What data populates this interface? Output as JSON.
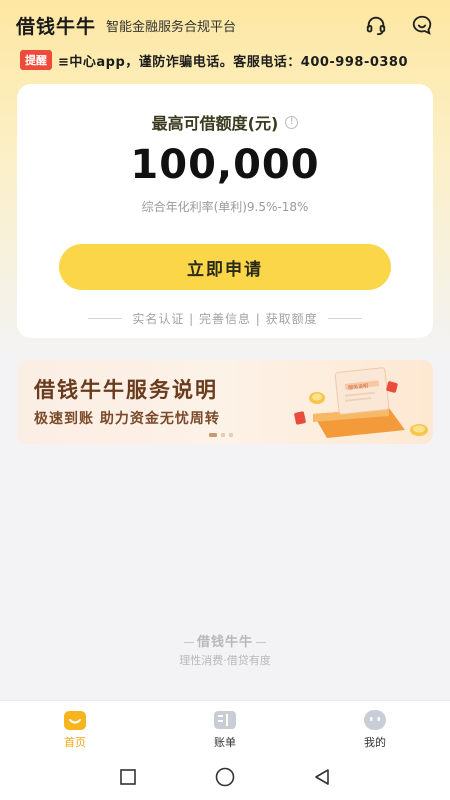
{
  "header": {
    "brand": "借钱牛牛",
    "slogan": "智能金融服务合规平台",
    "icons": [
      "headset-icon",
      "chat-icon"
    ]
  },
  "notice": {
    "tag": "提醒",
    "text": "≡中心app，谨防诈骗电话。客服电话：400-998-0380"
  },
  "loan_card": {
    "title": "最高可借额度(元)",
    "info_glyph": "!",
    "amount": "100,000",
    "rate": "综合年化利率(单利)9.5%-18%",
    "apply_label": "立即申请",
    "steps": "实名认证 | 完善信息 | 获取额度"
  },
  "banner": {
    "title": "借钱牛牛服务说明",
    "subtitle": "极速到账 助力资金无忧周转",
    "doc_label": "服务说明"
  },
  "footer": {
    "brand": "借钱牛牛",
    "slogan": "理性消费·借贷有度"
  },
  "bottom_nav": {
    "items": [
      {
        "label": "首页",
        "icon": "home-icon",
        "active": true
      },
      {
        "label": "账单",
        "icon": "bill-icon",
        "active": false
      },
      {
        "label": "我的",
        "icon": "profile-icon",
        "active": false
      }
    ]
  },
  "colors": {
    "accent": "#fbd649",
    "active_tab": "#f2a814",
    "banner_text": "#6b3b1e",
    "notice_tag": "#ef4a3a"
  }
}
